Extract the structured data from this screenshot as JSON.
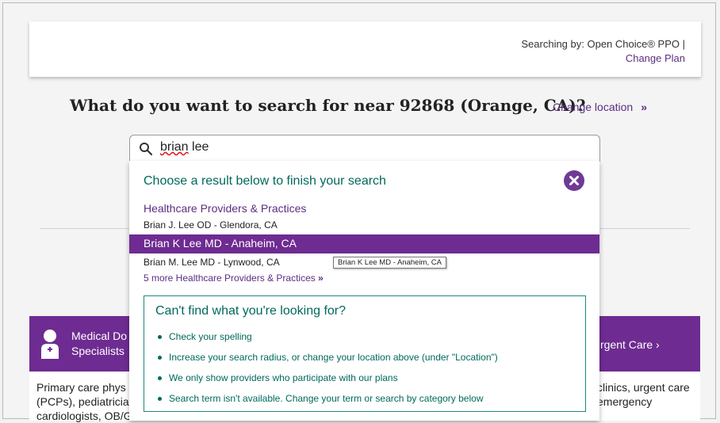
{
  "plan": {
    "searching_by": "Searching by: Open Choice® PPO |",
    "change_plan": "Change Plan"
  },
  "search": {
    "headline": "What do you want to search for near 92868 (Orange, CA)?",
    "change_location": "Change location",
    "change_location_chevron": "»",
    "query_first": "brian",
    "query_rest": " lee"
  },
  "dropdown": {
    "title": "Choose a result below to finish your search",
    "section_title": "Healthcare Providers & Practices",
    "results": [
      "Brian J. Lee OD - Glendora, CA",
      "Brian K Lee MD - Anaheim, CA",
      "Brian M. Lee MD - Lynwood, CA"
    ],
    "tooltip": "Brian K Lee MD - Anaheim, CA",
    "more_link": "5 more Healthcare Providers & Practices",
    "more_chevron": "»"
  },
  "help": {
    "title": "Can't find what you're looking for?",
    "tips": [
      "Check your spelling",
      "Increase your search radius, or change your location above (under \"Location\")",
      "We only show providers who participate with our plans",
      "Search term isn't available. Change your term or search by category below"
    ]
  },
  "categories": {
    "left_title_1": "Medical Do",
    "left_title_2": "Specialists",
    "left_text_1": "Primary care phys",
    "left_text_2": "(PCPs), pediatricia",
    "left_text_3": "cardiologists, OB/G",
    "right_title": "rgent Care",
    "right_chevron": "›",
    "right_text_1": "clinics, urgent care",
    "right_text_2": "emergency"
  },
  "colors": {
    "brand_purple": "#6e2b91",
    "link_purple": "#5c2d82",
    "teal": "#00695c"
  }
}
